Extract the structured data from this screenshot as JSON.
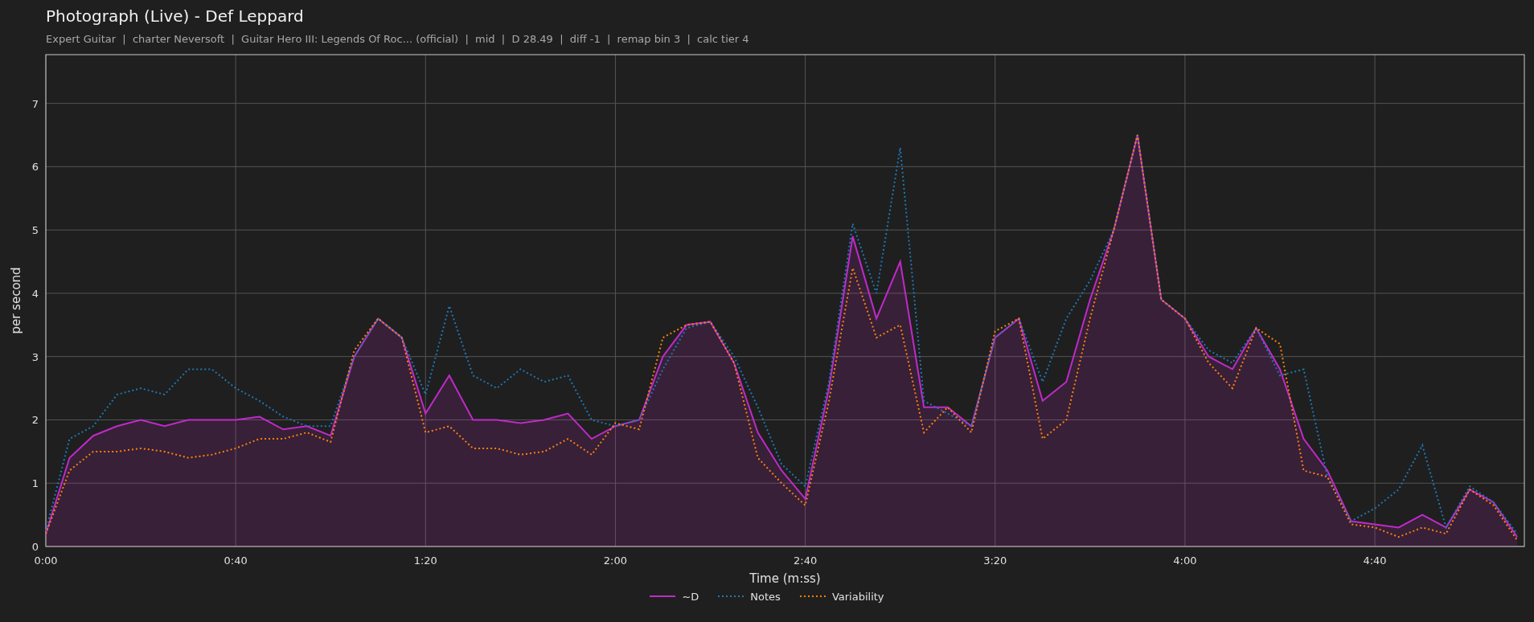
{
  "title": "Photograph (Live) - Def Leppard",
  "subtitle": "Expert Guitar  |  charter Neversoft  |  Guitar Hero III: Legends Of Roc... (official)  |  mid  |  D 28.49  |  diff -1  |  remap bin 3  |  calc tier 4",
  "chart": {
    "chart_data": {
      "type": "line",
      "xlabel": "Time (m:ss)",
      "ylabel": "per second",
      "x": [
        0,
        5,
        10,
        15,
        20,
        25,
        30,
        35,
        40,
        45,
        50,
        55,
        60,
        65,
        70,
        75,
        80,
        85,
        90,
        95,
        100,
        105,
        110,
        115,
        120,
        125,
        130,
        135,
        140,
        145,
        150,
        155,
        160,
        165,
        170,
        175,
        180,
        185,
        190,
        195,
        200,
        205,
        210,
        215,
        220,
        225,
        230,
        235,
        240,
        245,
        250,
        255,
        260,
        265,
        270,
        275,
        280,
        285,
        290,
        295,
        300,
        305,
        310
      ],
      "series": [
        {
          "name": "~D",
          "color": "#c02ac8",
          "type": "area",
          "line_style": "solid",
          "values": [
            0.2,
            1.4,
            1.75,
            1.9,
            2.0,
            1.9,
            2.0,
            2.0,
            2.0,
            2.05,
            1.85,
            1.9,
            1.75,
            3.0,
            3.6,
            3.3,
            2.1,
            2.7,
            2.0,
            2.0,
            1.95,
            2.0,
            2.1,
            1.7,
            1.9,
            2.0,
            3.0,
            3.5,
            3.55,
            2.9,
            1.8,
            1.2,
            0.75,
            2.5,
            4.9,
            3.6,
            4.5,
            2.2,
            2.2,
            1.9,
            3.3,
            3.6,
            2.3,
            2.6,
            3.9,
            5.0,
            6.5,
            3.9,
            3.6,
            3.0,
            2.8,
            3.45,
            2.8,
            1.7,
            1.2,
            0.4,
            0.35,
            0.3,
            0.5,
            0.3,
            0.9,
            0.7,
            0.15
          ]
        },
        {
          "name": "Notes",
          "color": "#1f77b4",
          "type": "line",
          "line_style": "dotted",
          "values": [
            0.25,
            1.7,
            1.9,
            2.4,
            2.5,
            2.4,
            2.8,
            2.8,
            2.5,
            2.3,
            2.05,
            1.9,
            1.9,
            3.0,
            3.6,
            3.3,
            2.4,
            3.8,
            2.7,
            2.5,
            2.8,
            2.6,
            2.7,
            2.0,
            1.9,
            2.0,
            2.8,
            3.45,
            3.55,
            3.0,
            2.2,
            1.3,
            0.95,
            2.6,
            5.1,
            4.0,
            6.3,
            2.3,
            2.1,
            1.9,
            3.3,
            3.6,
            2.6,
            3.6,
            4.2,
            5.0,
            6.5,
            3.9,
            3.6,
            3.1,
            2.9,
            3.45,
            2.7,
            2.8,
            1.1,
            0.4,
            0.6,
            0.9,
            1.6,
            0.3,
            0.95,
            0.7,
            0.2
          ]
        },
        {
          "name": "Variability",
          "color": "#ff7f0e",
          "type": "line",
          "line_style": "dotted",
          "values": [
            0.2,
            1.2,
            1.5,
            1.5,
            1.55,
            1.5,
            1.4,
            1.45,
            1.55,
            1.7,
            1.7,
            1.8,
            1.65,
            3.1,
            3.6,
            3.3,
            1.8,
            1.9,
            1.55,
            1.55,
            1.45,
            1.5,
            1.7,
            1.45,
            1.95,
            1.85,
            3.3,
            3.5,
            3.55,
            2.9,
            1.4,
            1.0,
            0.65,
            2.3,
            4.4,
            3.3,
            3.5,
            1.8,
            2.2,
            1.8,
            3.4,
            3.6,
            1.7,
            2.0,
            3.6,
            5.0,
            6.5,
            3.9,
            3.6,
            2.9,
            2.5,
            3.45,
            3.2,
            1.2,
            1.1,
            0.35,
            0.3,
            0.15,
            0.3,
            0.2,
            0.9,
            0.65,
            0.1
          ]
        }
      ],
      "xlim": [
        0,
        311.5
      ],
      "ylim": [
        0,
        7.77
      ],
      "xticks": [
        {
          "value": 0,
          "label": "0:00"
        },
        {
          "value": 40,
          "label": "0:40"
        },
        {
          "value": 80,
          "label": "1:20"
        },
        {
          "value": 120,
          "label": "2:00"
        },
        {
          "value": 160,
          "label": "2:40"
        },
        {
          "value": 200,
          "label": "3:20"
        },
        {
          "value": 240,
          "label": "4:00"
        },
        {
          "value": 280,
          "label": "4:40"
        }
      ],
      "yticks": [
        0,
        1,
        2,
        3,
        4,
        5,
        6,
        7
      ],
      "grid": true
    }
  }
}
